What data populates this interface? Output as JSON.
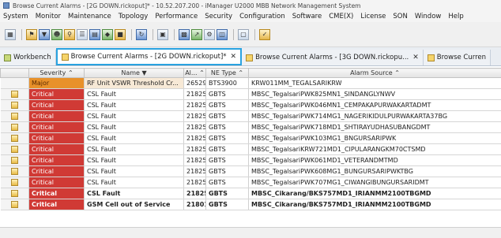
{
  "window": {
    "title": "Browse Current Alarms - [2G DOWN.rickoput]* - 10.52.207.200 - iManager U2000 MBB Network Management System"
  },
  "menu": [
    "System",
    "Monitor",
    "Maintenance",
    "Topology",
    "Performance",
    "Security",
    "Configuration",
    "Software",
    "CME(X)",
    "License",
    "SON",
    "Window",
    "Help"
  ],
  "toolbar": {
    "icons": [
      "grid-icon",
      "alarm-icon",
      "filter-icon",
      "user-icon",
      "search-icon",
      "list-icon",
      "chart-icon",
      "topology-icon",
      "lock-icon",
      "refresh-icon",
      "network-icon",
      "monitor-icon",
      "export-icon",
      "settings-icon",
      "tile-icon",
      "pin-icon"
    ]
  },
  "tabs": [
    {
      "label": "Workbench",
      "active": false,
      "closable": false
    },
    {
      "label": "Browse Current Alarms - [2G DOWN.rickoput]*",
      "active": true,
      "closable": true
    },
    {
      "label": "Browse Current Alarms - [3G DOWN.rickopu...",
      "active": false,
      "closable": true
    },
    {
      "label": "Browse Curren",
      "active": false,
      "closable": false
    }
  ],
  "table": {
    "columns": [
      "",
      "Severity",
      "Name",
      "Al...",
      "NE Type",
      "Alarm Source"
    ],
    "rows": [
      {
        "severity": "Major",
        "name": "RF Unit VSWR Threshold Cr...",
        "id": "26529",
        "ne_type": "BTS3900",
        "source": "KRW011MM_TEGALSARIKRW",
        "bold": false,
        "ack": false
      },
      {
        "severity": "Critical",
        "name": "CSL Fault",
        "id": "21825",
        "ne_type": "GBTS",
        "source": "MBSC_TegalsariPWK825MN1_SINDANGLYNWV",
        "bold": false,
        "ack": true
      },
      {
        "severity": "Critical",
        "name": "CSL Fault",
        "id": "21825",
        "ne_type": "GBTS",
        "source": "MBSC_TegalsariPWK046MN1_CEMPAKAPURWAKARTADMT",
        "bold": false,
        "ack": true
      },
      {
        "severity": "Critical",
        "name": "CSL Fault",
        "id": "21825",
        "ne_type": "GBTS",
        "source": "MBSC_TegalsariPWK714MG1_NAGERIKIDULPURWAKARTA37BG",
        "bold": false,
        "ack": true
      },
      {
        "severity": "Critical",
        "name": "CSL Fault",
        "id": "21825",
        "ne_type": "GBTS",
        "source": "MBSC_TegalsariPWK718MD1_SHTIRAYUDHASUBANGDMT",
        "bold": false,
        "ack": true
      },
      {
        "severity": "Critical",
        "name": "CSL Fault",
        "id": "21825",
        "ne_type": "GBTS",
        "source": "MBSC_TegalsariPWK103MG1_BNGURSARIPWK",
        "bold": false,
        "ack": true
      },
      {
        "severity": "Critical",
        "name": "CSL Fault",
        "id": "21825",
        "ne_type": "GBTS",
        "source": "MBSC_TegalsariKRW721MD1_CIPULARANGKM70CTSMD",
        "bold": false,
        "ack": true
      },
      {
        "severity": "Critical",
        "name": "CSL Fault",
        "id": "21825",
        "ne_type": "GBTS",
        "source": "MBSC_TegalsariPWK061MD1_VETERANDMTMD",
        "bold": false,
        "ack": true
      },
      {
        "severity": "Critical",
        "name": "CSL Fault",
        "id": "21825",
        "ne_type": "GBTS",
        "source": "MBSC_TegalsariPWK608MG1_BUNGURSARIPWKTBG",
        "bold": false,
        "ack": true
      },
      {
        "severity": "Critical",
        "name": "CSL Fault",
        "id": "21825",
        "ne_type": "GBTS",
        "source": "MBSC_TegalsariPWK707MG1_CIWANGIBUNGURSARIDMT",
        "bold": false,
        "ack": true
      },
      {
        "severity": "Critical",
        "name": "CSL Fault",
        "id": "21825",
        "ne_type": "GBTS",
        "source": "MBSC_Cikarang/BKS757MD1_IRIANMM2100TBGMD",
        "bold": true,
        "ack": true
      },
      {
        "severity": "Critical",
        "name": "GSM Cell out of Service",
        "id": "21801",
        "ne_type": "GBTS",
        "source": "MBSC_Cikarang/BKS757MD1_IRIANMM2100TBGMD",
        "bold": true,
        "ack": true
      }
    ]
  },
  "colors": {
    "critical": "#d03a35",
    "major": "#e8912a",
    "active_tab_border": "#2aa3e0"
  }
}
